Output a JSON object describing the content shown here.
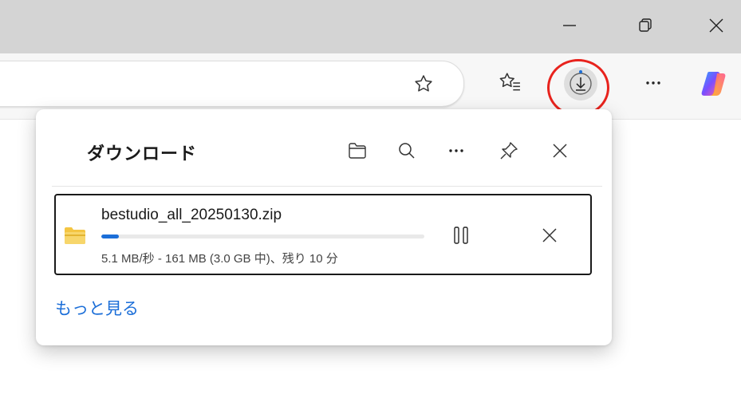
{
  "window": {
    "controls": {
      "minimize_icon": "minimize-icon",
      "restore_icon": "restore-icon",
      "close_icon": "close-icon"
    }
  },
  "toolbar": {
    "icons": [
      "favorite-star-icon",
      "favorites-list-icon",
      "downloads-icon",
      "more-icon",
      "copilot-icon"
    ],
    "downloads_active": true
  },
  "downloads_flyout": {
    "title": "ダウンロード",
    "header_icons": [
      "open-folder-icon",
      "search-icon",
      "more-options-icon",
      "pin-icon",
      "close-icon"
    ],
    "items": [
      {
        "filename": "bestudio_all_20250130.zip",
        "status": "5.1 MB/秒 - 161 MB (3.0 GB 中)、残り 10 分",
        "progress": 0.054
      }
    ],
    "see_more": "もっと見る"
  },
  "colors": {
    "accent": "#1b6ed8",
    "highlight": "#e8231d",
    "titlebar": "#d4d4d4",
    "toolbar": "#f7f7f7"
  }
}
